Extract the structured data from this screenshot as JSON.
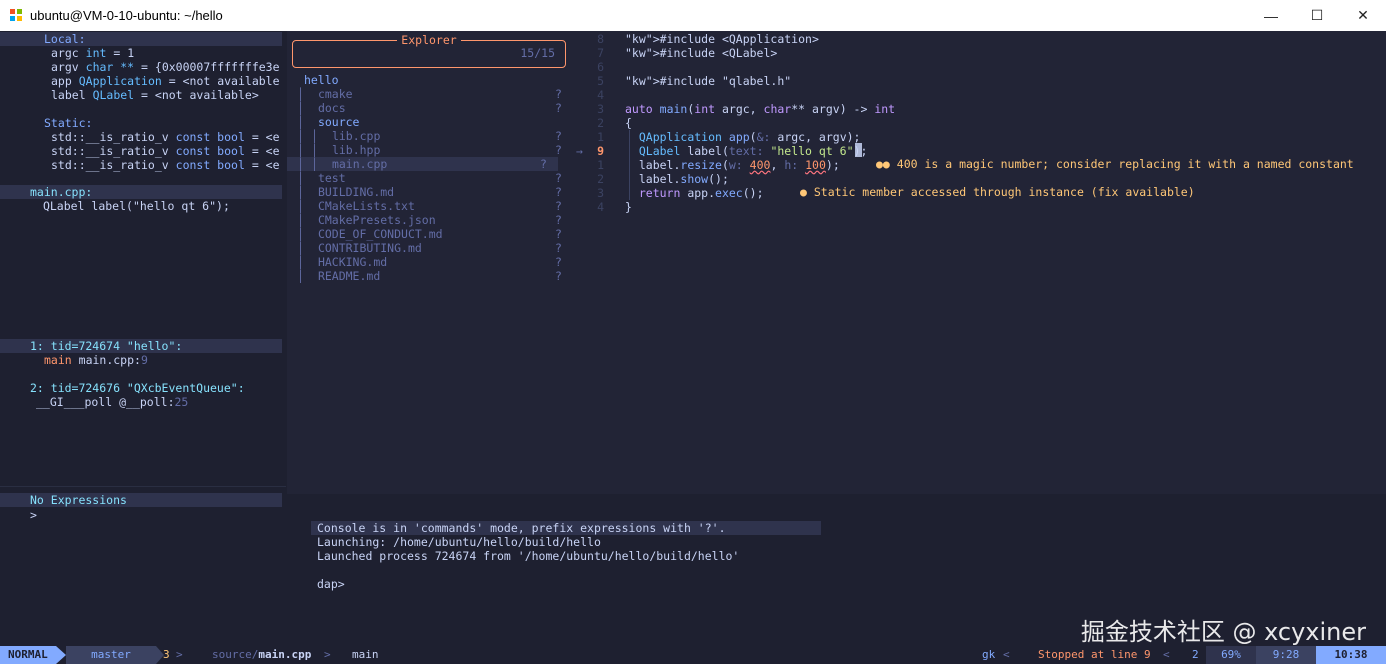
{
  "window": {
    "title": "ubuntu@VM-0-10-ubuntu: ~/hello",
    "minimize": "—",
    "maximize": "☐",
    "close": "✕"
  },
  "scopes": {
    "local_header": "Local:",
    "locals": [
      {
        "name": "argc",
        "type": "int",
        "value": "= 1"
      },
      {
        "name": "argv",
        "type": "char **",
        "value": "= {0x00007fffffffe3e"
      },
      {
        "name": "app",
        "type": "QApplication",
        "value": "= <not available"
      },
      {
        "name": "label",
        "type": "QLabel",
        "value": "= <not available>"
      }
    ],
    "static_header": "Static:",
    "statics": [
      {
        "name": "std::__is_ratio_v",
        "type": "const bool",
        "value": "= <e"
      },
      {
        "name": "std::__is_ratio_v",
        "type": "const bool",
        "value": "= <e"
      },
      {
        "name": "std::__is_ratio_v",
        "type": "const bool",
        "value": "= <e"
      }
    ]
  },
  "breakpoints": {
    "file": "main.cpp:",
    "icon": "",
    "code": "QLabel label(\"hello qt 6\");"
  },
  "threads": [
    {
      "header": "1: tid=724674 \"hello\":",
      "frame_fn": "main",
      "frame_loc": "main.cpp:",
      "frame_line": "9"
    },
    {
      "header": "2: tid=724676 \"QXcbEventQueue\":",
      "frame_fn": "__GI___poll",
      "frame_loc": "@__poll:",
      "frame_line": "25"
    }
  ],
  "watches": {
    "header": "No Expressions",
    "prompt": ">"
  },
  "explorer": {
    "title": "Explorer",
    "count": "15/15",
    "root": "hello",
    "items": [
      {
        "indent": 1,
        "icon": "",
        "label": "cmake",
        "status": "?"
      },
      {
        "indent": 1,
        "icon": "",
        "label": "docs",
        "status": "?"
      },
      {
        "indent": 1,
        "icon": "",
        "label": "source",
        "status": ""
      },
      {
        "indent": 2,
        "icon": "",
        "label": "lib.cpp",
        "status": "?"
      },
      {
        "indent": 2,
        "icon": "",
        "label": "lib.hpp",
        "status": "?"
      },
      {
        "indent": 2,
        "icon": "",
        "label": "main.cpp",
        "status": "?"
      },
      {
        "indent": 1,
        "icon": "",
        "label": "test",
        "status": "?"
      },
      {
        "indent": 1,
        "icon": "",
        "label": "BUILDING.md",
        "status": "?"
      },
      {
        "indent": 1,
        "icon": "",
        "label": "CMakeLists.txt",
        "status": "?"
      },
      {
        "indent": 1,
        "icon": "",
        "label": "CMakePresets.json",
        "status": "?"
      },
      {
        "indent": 1,
        "icon": "",
        "label": "CODE_OF_CONDUCT.md",
        "status": "?"
      },
      {
        "indent": 1,
        "icon": "",
        "label": "CONTRIBUTING.md",
        "status": "?"
      },
      {
        "indent": 1,
        "icon": "",
        "label": "HACKING.md",
        "status": "?"
      },
      {
        "indent": 1,
        "icon": "",
        "label": "README.md",
        "status": "?"
      }
    ]
  },
  "editor": {
    "line_numbers": [
      "8",
      "7",
      "6",
      "5",
      "4",
      "3",
      "2",
      "1",
      "9",
      "1",
      "2",
      "3",
      "4"
    ],
    "current_marker": "→",
    "lines": [
      "#include <QApplication>",
      "#include <QLabel>",
      "",
      "#include \"qlabel.h\"",
      "",
      "auto main(int argc, char** argv) -> int",
      "{",
      "  QApplication app(&: argc, argv);",
      "  QLabel label(text: \"hello qt 6\");",
      "  label.resize(w: 400, h: 100);",
      "  label.show();",
      "  return app.exec();",
      "}"
    ],
    "diag_1": "●● 400 is a magic number; consider replacing it with a named constant",
    "diag_2": "● Static member accessed through instance (fix available)"
  },
  "console": {
    "lines": [
      "Console is in 'commands' mode, prefix expressions with '?'.",
      "Launching: /home/ubuntu/hello/build/hello",
      "Launched process 724674 from '/home/ubuntu/hello/build/hello'",
      "",
      "dap>"
    ]
  },
  "statusline": {
    "mode": "NORMAL",
    "branch": "master",
    "diag_count": "3",
    "sep": ">",
    "file_icon": "",
    "path_dir": "source/",
    "path_file": "main.cpp",
    "sep2": ">",
    "symbol_icon": "",
    "symbol": "main",
    "key": "gk",
    "lt1": "<",
    "dap_status": "Stopped at line 9",
    "lt2": "<",
    "misc": "2",
    "percent": "69%",
    "position": "9:28",
    "time": "10:38"
  },
  "watermark": "掘金技术社区 @ xcyxiner",
  "colors": {
    "bg": "#1e2030",
    "accent": "#82aaff",
    "mode_bg": "#82aaff",
    "explorer_border": "#ff966c"
  }
}
